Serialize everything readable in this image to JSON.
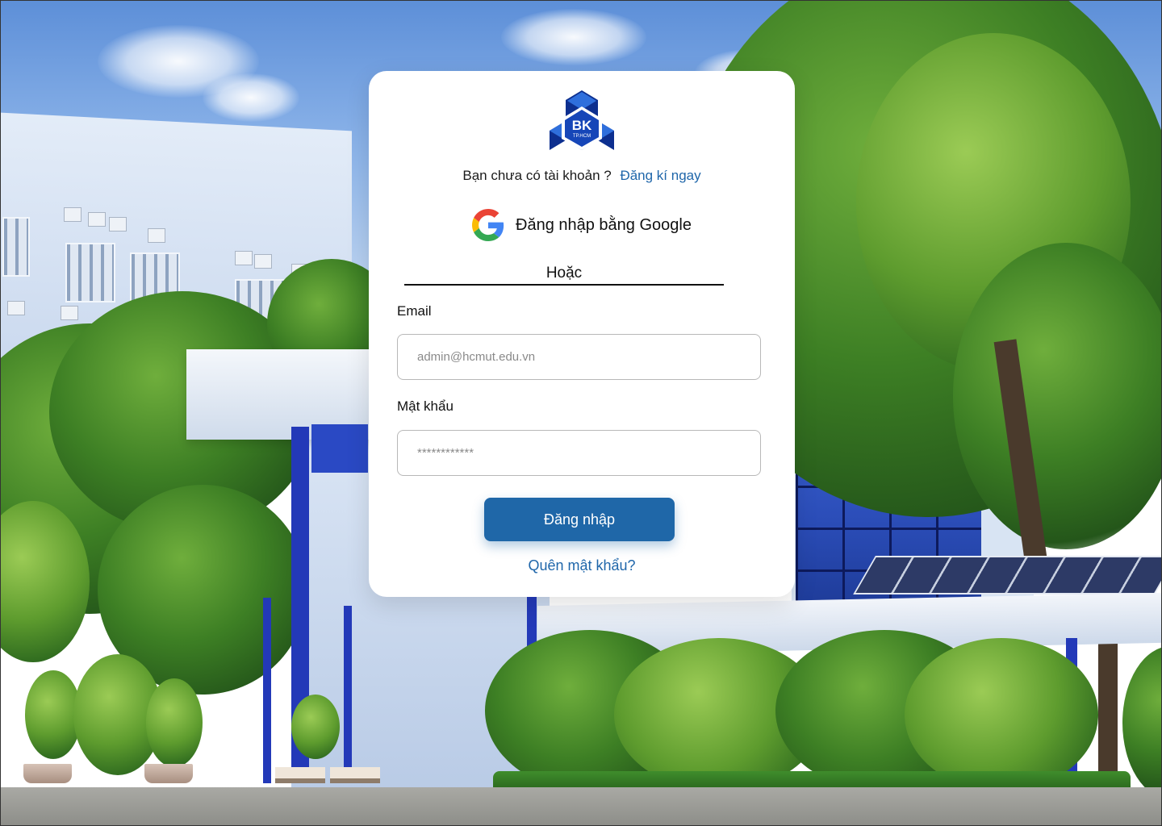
{
  "logo": {
    "text": "BK",
    "subtext": "TP.HCM",
    "colors": {
      "dark": "#0d2f8f",
      "light": "#2f6fdc"
    }
  },
  "signup": {
    "question": "Bạn chưa có tài khoản ?",
    "link_label": "Đăng kí ngay"
  },
  "google": {
    "icon": "google-icon",
    "label": "Đăng nhập bằng Google"
  },
  "divider": {
    "label": "Hoặc"
  },
  "form": {
    "email_label": "Email",
    "email_placeholder": "admin@hcmut.edu.vn",
    "password_label": "Mật khẩu",
    "password_placeholder": "************",
    "submit_label": "Đăng nhập",
    "forgot_label": "Quên mật khẩu?"
  },
  "colors": {
    "accent": "#1f67a8",
    "link": "#1f66aa",
    "card": "#ffffff"
  }
}
